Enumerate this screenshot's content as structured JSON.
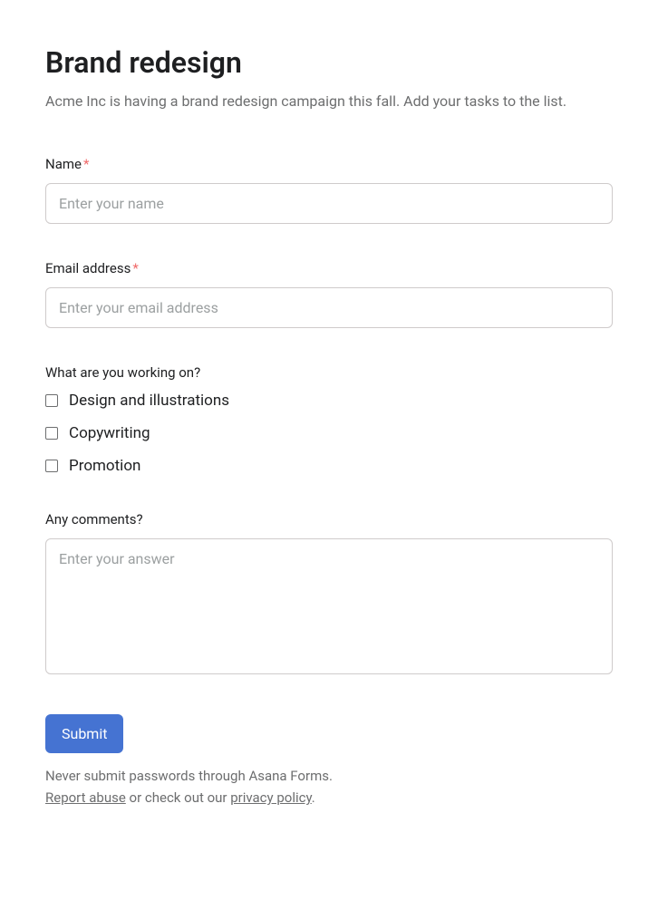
{
  "header": {
    "title": "Brand redesign",
    "description": "Acme Inc is having a brand redesign campaign this fall. Add your tasks to the list."
  },
  "fields": {
    "name": {
      "label": "Name",
      "required_marker": "*",
      "placeholder": "Enter your name"
    },
    "email": {
      "label": "Email address",
      "required_marker": "*",
      "placeholder": "Enter your email address"
    },
    "work": {
      "label": "What are you working on?",
      "options": [
        "Design and illustrations",
        "Copywriting",
        "Promotion"
      ]
    },
    "comments": {
      "label": "Any comments?",
      "placeholder": "Enter your answer"
    }
  },
  "submit": {
    "label": "Submit"
  },
  "footer": {
    "note": "Never submit passwords through Asana Forms.",
    "report_abuse": "Report abuse",
    "middle": " or check out our ",
    "privacy_policy": "privacy policy",
    "period": "."
  }
}
